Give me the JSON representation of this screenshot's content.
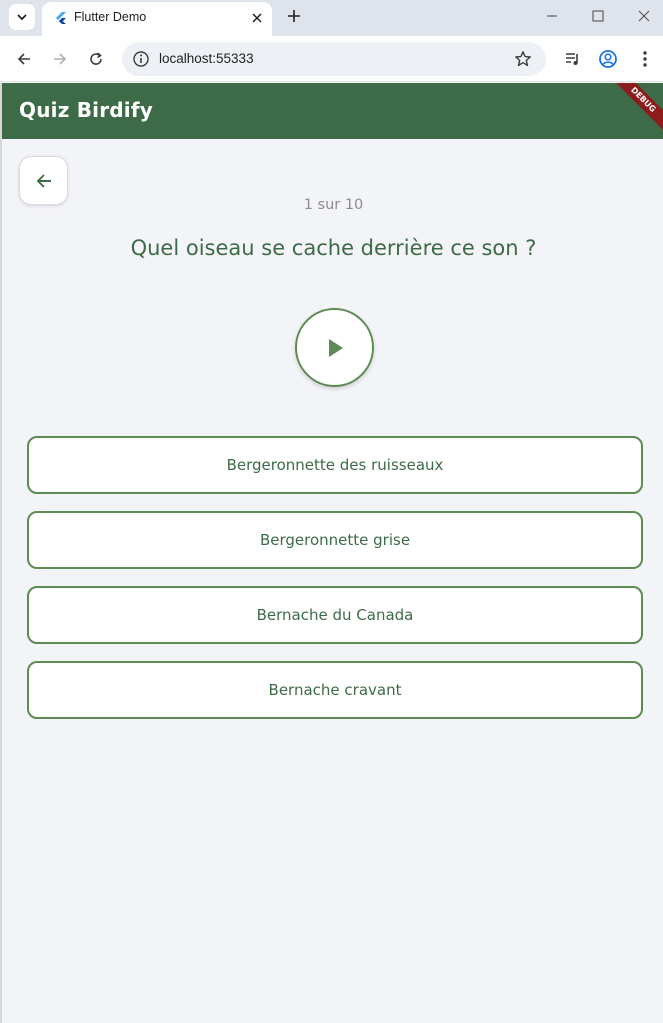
{
  "browser": {
    "tab_title": "Flutter Demo",
    "url": "localhost:55333"
  },
  "app": {
    "title": "Quiz Birdify",
    "debug_label": "DEBUG",
    "progress_text": "1 sur 10",
    "question": "Quel oiseau se cache derrière ce son ?",
    "answers": [
      "Bergeronnette des ruisseaux",
      "Bergeronnette grise",
      "Bernache du Canada",
      "Bernache cravant"
    ]
  },
  "colors": {
    "primary": "#3e6b47",
    "accent": "#5e8a54",
    "debug": "#8c1b1b"
  }
}
